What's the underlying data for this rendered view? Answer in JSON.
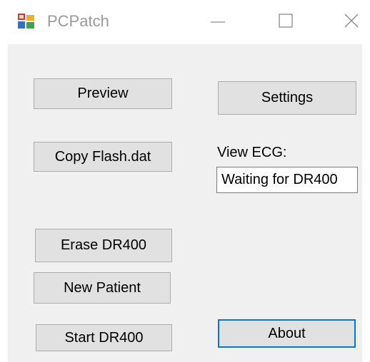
{
  "window": {
    "title": "PCPatch",
    "icon": "pcpatch-app-icon",
    "controls": {
      "minimize_icon": "minimize-icon",
      "maximize_icon": "maximize-icon",
      "close_icon": "close-icon"
    }
  },
  "buttons": {
    "preview": "Preview",
    "settings": "Settings",
    "copy_flash": "Copy Flash.dat",
    "erase": "Erase DR400",
    "new_patient": "New Patient",
    "start": "Start DR400",
    "about": "About"
  },
  "view_ecg": {
    "label": "View ECG:",
    "status_value": "Waiting for DR400"
  },
  "colors": {
    "client_background": "#f0f0f0",
    "button_face": "#e1e1e1",
    "button_border": "#adadad",
    "focus_border": "#0078d7",
    "title_text": "#9a9a9a"
  }
}
